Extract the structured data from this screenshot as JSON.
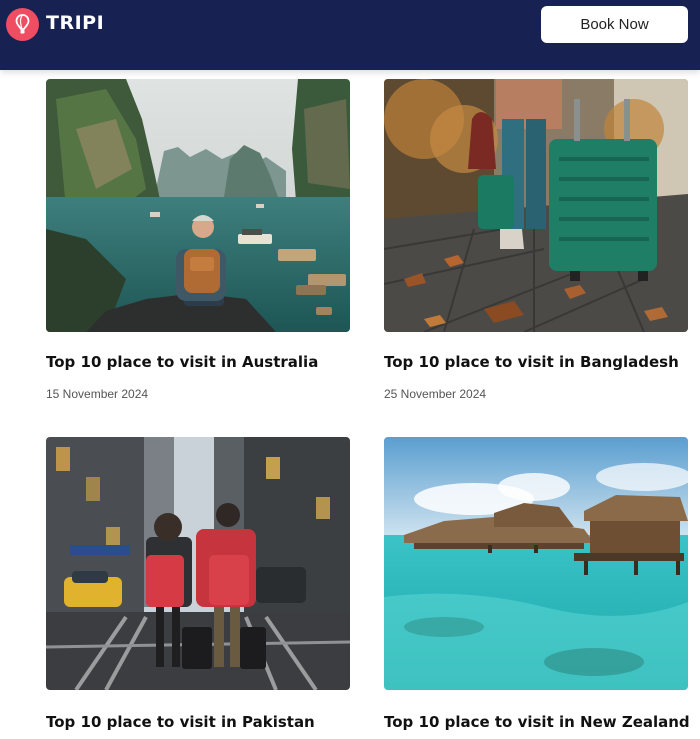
{
  "header": {
    "logo_text": "TRIPI",
    "logo_icon": "hot-air-balloon-icon",
    "book_label": "Book Now",
    "colors": {
      "background": "#172152",
      "logo_accent": "#f04d63",
      "button_bg": "#ffffff"
    }
  },
  "posts": [
    {
      "title": "Top 10 place to visit in Australia",
      "date": "15 November 2024",
      "image": "karst-bay-traveler"
    },
    {
      "title": "Top 10 place to visit in Bangladesh",
      "date": "25 November 2024",
      "image": "street-luggage-autumn"
    },
    {
      "title": "Top 10 place to visit in Pakistan",
      "date": "",
      "image": "city-street-red-luggage"
    },
    {
      "title": "Top 10 place to visit in New Zealand",
      "date": "",
      "image": "overwater-bungalows"
    }
  ]
}
